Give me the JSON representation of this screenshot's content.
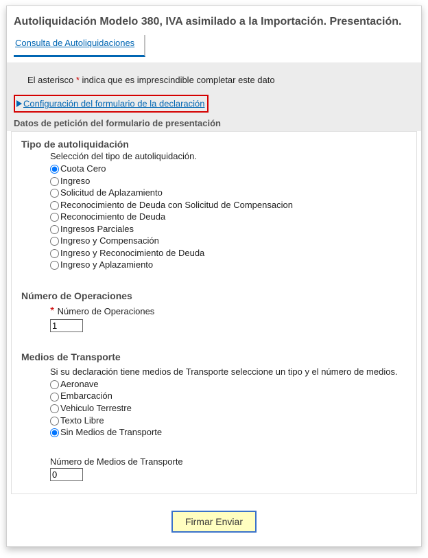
{
  "title": "Autoliquidación Modelo 380, IVA asimilado a la Importación. Presentación.",
  "tab_label": "Consulta de Autoliquidaciones",
  "hint_pre": "El asterisco ",
  "hint_mark": "*",
  "hint_post": " indica que es imprescindible completar este dato",
  "config_link": "Configuración del formulario de la declaración",
  "section_header": "Datos de petición del formulario de presentación",
  "tipo": {
    "title": "Tipo de autoliquidación",
    "sub": "Selección del tipo de autoliquidación.",
    "options": [
      "Cuota Cero",
      "Ingreso",
      "Solicitud de Aplazamiento",
      "Reconocimiento de Deuda con Solicitud de Compensacion",
      "Reconocimiento de Deuda",
      "Ingresos Parciales",
      "Ingreso y Compensación",
      "Ingreso y Reconocimiento de Deuda",
      "Ingreso y Aplazamiento"
    ],
    "selected": 0
  },
  "numops": {
    "title": "Número de Operaciones",
    "label": "Número de Operaciones",
    "value": "1"
  },
  "medios": {
    "title": "Medios de Transporte",
    "sub": "Si su declaración tiene medios de Transporte seleccione un tipo y el número de medios.",
    "options": [
      "Aeronave",
      "Embarcación",
      "Vehiculo Terrestre",
      "Texto Libre",
      "Sin Medios de Transporte"
    ],
    "selected": 4,
    "numlabel": "Número de Medios de Transporte",
    "numvalue": "0"
  },
  "submit": "Firmar Enviar"
}
